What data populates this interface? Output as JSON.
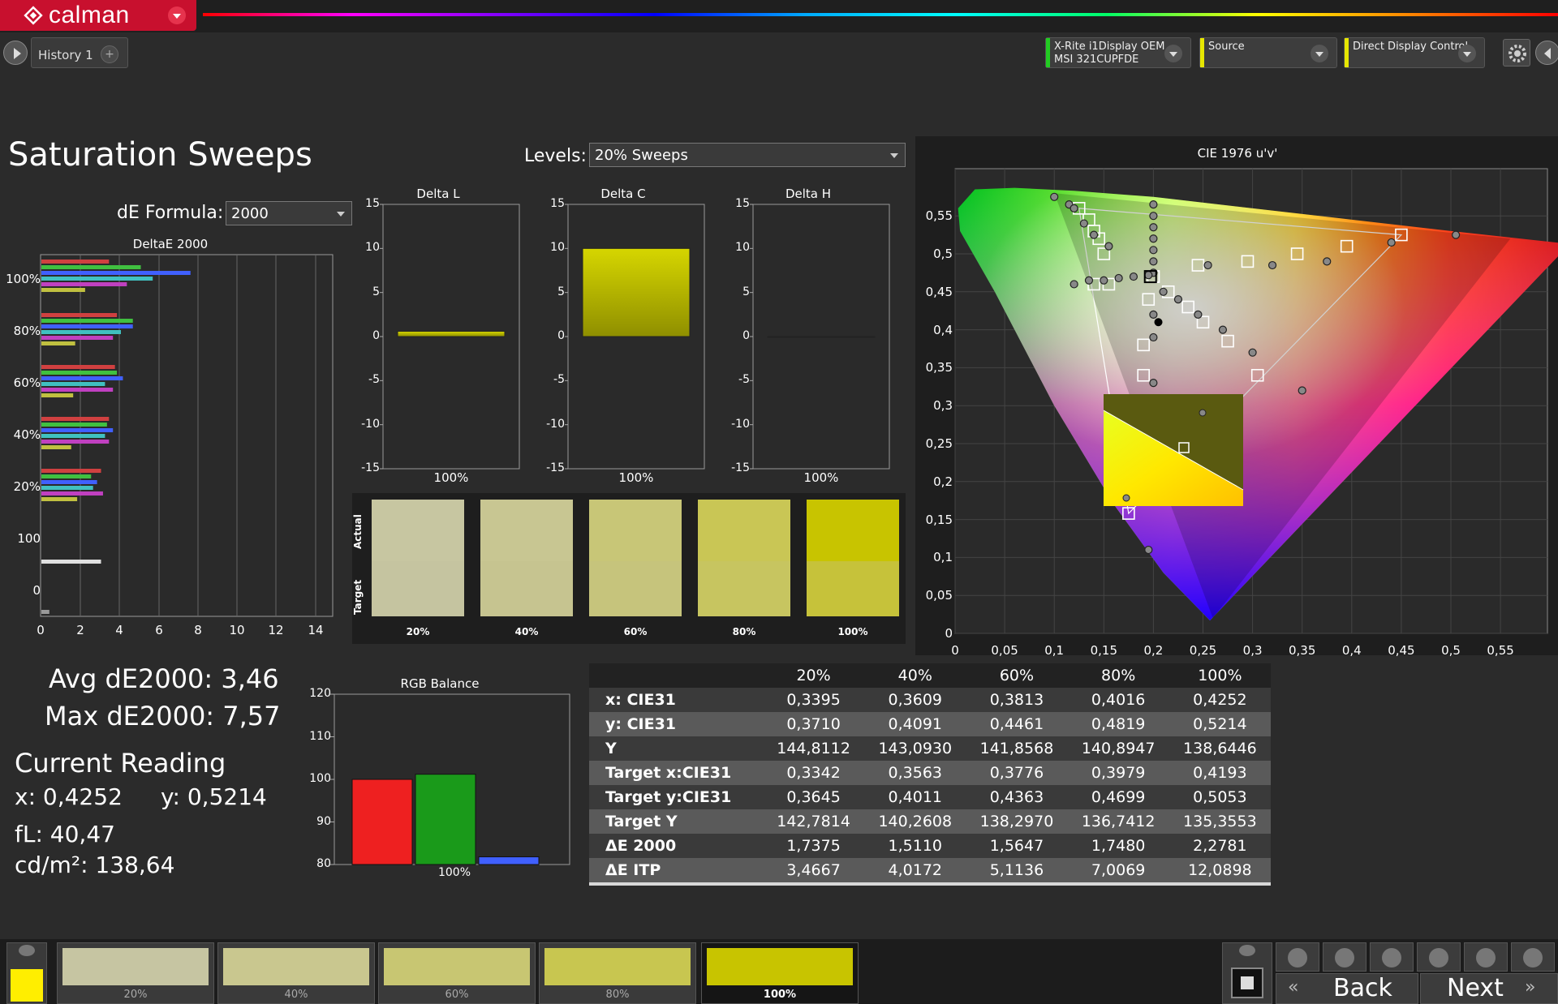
{
  "app": {
    "logo_text": "calman",
    "history_tab": "History 1",
    "history_plus": "+",
    "devices": [
      {
        "line1": "X-Rite i1Display OEM",
        "line2": "MSI 321CUPFDE",
        "color": "#22cc22"
      },
      {
        "line1": "Source",
        "line2": "",
        "color": "#e6e600"
      },
      {
        "line1": "Direct Display Control",
        "line2": "",
        "color": "#e6e600"
      }
    ]
  },
  "page": {
    "title": "Saturation Sweeps",
    "levels_label": "Levels:",
    "levels_value": "20% Sweeps",
    "de_formula_label": "dE Formula:",
    "de_formula_value": "2000"
  },
  "deltae_chart": {
    "title": "DeltaE 2000",
    "xticks": [
      "0",
      "2",
      "4",
      "6",
      "8",
      "10",
      "12",
      "14"
    ],
    "ylabels": [
      "100%",
      "80%",
      "60%",
      "40%",
      "20%",
      "100",
      "0"
    ]
  },
  "delta_charts": [
    {
      "title": "Delta L",
      "category": "100%",
      "value": 0.6
    },
    {
      "title": "Delta C",
      "category": "100%",
      "value": 10.0
    },
    {
      "title": "Delta H",
      "category": "100%",
      "value": 0.0
    }
  ],
  "delta_yticks": [
    "15",
    "10",
    "5",
    "0",
    "-5",
    "-10",
    "-15"
  ],
  "swatches": {
    "actual_label": "Actual",
    "target_label": "Target",
    "items": [
      {
        "label": "20%",
        "actual": "#c7c6a1",
        "target": "#c5c4a0"
      },
      {
        "label": "40%",
        "actual": "#c8c692",
        "target": "#c6c490"
      },
      {
        "label": "60%",
        "actual": "#c8c677",
        "target": "#c6c47c"
      },
      {
        "label": "80%",
        "actual": "#c9c655",
        "target": "#c7c560"
      },
      {
        "label": "100%",
        "actual": "#c8c400",
        "target": "#c6c23a"
      }
    ]
  },
  "cie": {
    "title": "CIE 1976 u'v'",
    "xticks": [
      "0",
      "0,05",
      "0,1",
      "0,15",
      "0,2",
      "0,25",
      "0,3",
      "0,35",
      "0,4",
      "0,45",
      "0,5",
      "0,55"
    ],
    "yticks": [
      "0",
      "0,05",
      "0,1",
      "0,15",
      "0,2",
      "0,25",
      "0,3",
      "0,35",
      "0,4",
      "0,45",
      "0,5",
      "0,55"
    ]
  },
  "stats": {
    "avg": "Avg dE2000: 3,46",
    "max": "Max dE2000: 7,57",
    "current_title": "Current Reading",
    "x": "x: 0,4252",
    "y": "y: 0,5214",
    "fl": "fL: 40,47",
    "cdm2": "cd/m²: 138,64"
  },
  "rgb_balance": {
    "title": "RGB Balance",
    "category": "100%",
    "yticks": [
      "120",
      "110",
      "100",
      "90",
      "80"
    ],
    "values": {
      "red": 100.0,
      "green": 101.2,
      "blue": 81.8
    }
  },
  "table": {
    "headers": [
      "",
      "20%",
      "40%",
      "60%",
      "80%",
      "100%"
    ],
    "rows": [
      [
        "x: CIE31",
        "0,3395",
        "0,3609",
        "0,3813",
        "0,4016",
        "0,4252"
      ],
      [
        "y: CIE31",
        "0,3710",
        "0,4091",
        "0,4461",
        "0,4819",
        "0,5214"
      ],
      [
        "Y",
        "144,8112",
        "143,0930",
        "141,8568",
        "140,8947",
        "138,6446"
      ],
      [
        "Target x:CIE31",
        "0,3342",
        "0,3563",
        "0,3776",
        "0,3979",
        "0,4193"
      ],
      [
        "Target y:CIE31",
        "0,3645",
        "0,4011",
        "0,4363",
        "0,4699",
        "0,5053"
      ],
      [
        "Target Y",
        "142,7814",
        "140,2608",
        "138,2970",
        "136,7412",
        "135,3553"
      ],
      [
        "ΔE 2000",
        "1,7375",
        "1,5110",
        "1,5647",
        "1,7480",
        "2,2781"
      ],
      [
        "ΔE ITP",
        "3,4667",
        "4,0172",
        "5,1136",
        "7,0069",
        "12,0898"
      ]
    ]
  },
  "bottom": {
    "thumbs": [
      {
        "label": "20%",
        "color": "#c6c5a2"
      },
      {
        "label": "40%",
        "color": "#c9c78f"
      },
      {
        "label": "60%",
        "color": "#c8c672"
      },
      {
        "label": "80%",
        "color": "#c8c650"
      },
      {
        "label": "100%",
        "color": "#c8c400"
      }
    ],
    "current_color": "#ffee00",
    "back": "Back",
    "next": "Next"
  }
}
